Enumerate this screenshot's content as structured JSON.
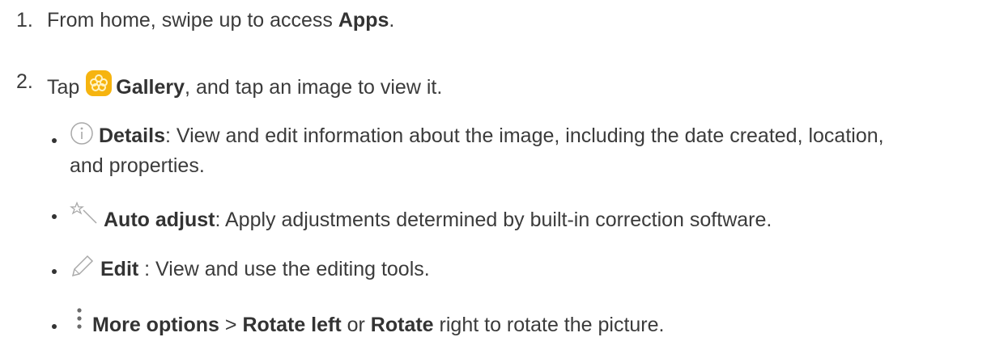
{
  "steps": [
    {
      "number": "1.",
      "prefix": "From home, swipe up to access ",
      "bold": "Apps",
      "suffix": "."
    },
    {
      "number": "2.",
      "prefix": "Tap ",
      "bold": "Gallery",
      "suffix": ", and tap an image to view it.",
      "icon": "gallery-icon",
      "icon_color": "#f5b800"
    }
  ],
  "bullets": [
    {
      "icon": "info-icon",
      "bold": "Details",
      "text_line1": ": View and edit information about the image, including the date created, location,",
      "text_line2": "and properties."
    },
    {
      "icon": "magic-wand-icon",
      "bold": "Auto adjust",
      "text": ": Apply adjustments determined by built-in correction software."
    },
    {
      "icon": "pencil-icon",
      "bold": "Edit",
      "text": " : View and use the editing tools."
    },
    {
      "icon": "more-options-icon",
      "bold1": "More options",
      "mid1": " > ",
      "bold2": "Rotate left",
      "mid2": " or ",
      "bold3": "Rotate",
      "end": " right to rotate the picture."
    }
  ]
}
